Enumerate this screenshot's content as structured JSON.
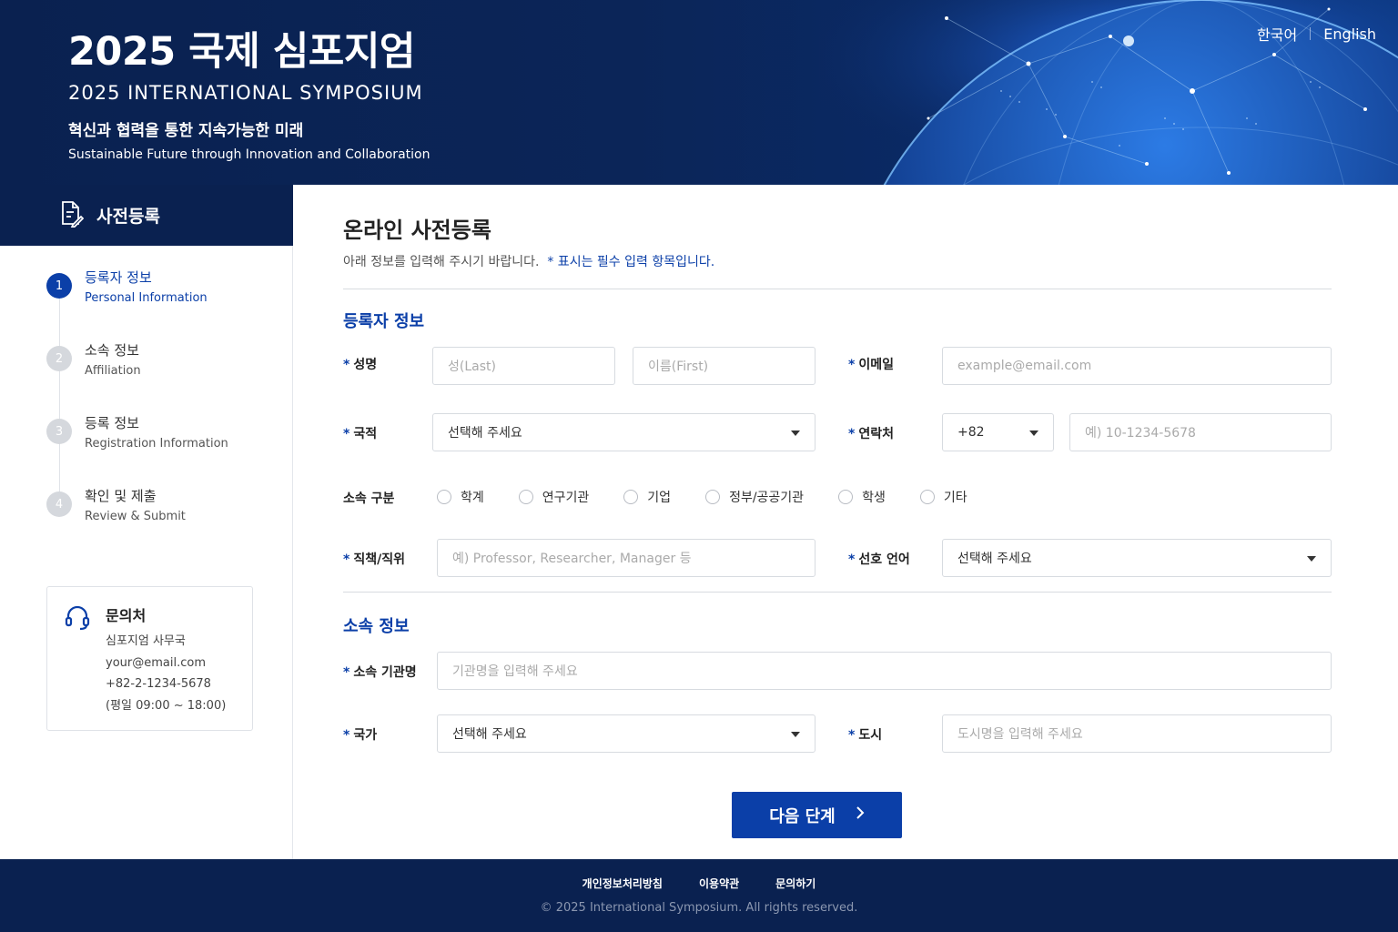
{
  "header": {
    "title_ko": "2025 국제 심포지엄",
    "title_en": "2025 INTERNATIONAL SYMPOSIUM",
    "subtitle_ko": "혁신과 협력을 통한 지속가능한 미래",
    "subtitle_en": "Sustainable Future through Innovation and Collaboration",
    "lang_ko": "한국어",
    "lang_en": "English"
  },
  "sidebar": {
    "title": "사전등록",
    "steps": [
      {
        "num": "1",
        "ko": "등록자 정보",
        "en": "Personal Information",
        "active": true
      },
      {
        "num": "2",
        "ko": "소속 정보",
        "en": "Affiliation",
        "active": false
      },
      {
        "num": "3",
        "ko": "등록 정보",
        "en": "Registration Information",
        "active": false
      },
      {
        "num": "4",
        "ko": "확인 및 제출",
        "en": "Review & Submit",
        "active": false
      }
    ],
    "contact": {
      "title": "문의처",
      "org": "심포지엄 사무국",
      "email": "your@email.com",
      "phone": "+82-2-1234-5678",
      "hours": "(평일 09:00 ~ 18:00)"
    }
  },
  "form": {
    "title": "온라인 사전등록",
    "desc": "아래 정보를 입력해 주시기 바랍니다.",
    "desc_req": "* 표시는 필수 입력 항목입니다.",
    "section1": "등록자 정보",
    "section2": "소속 정보",
    "required_mark": "*",
    "name_label": "성명",
    "last_placeholder": "성(Last)",
    "first_placeholder": "이름(First)",
    "email_label": "이메일",
    "email_placeholder": "example@email.com",
    "nationality_label": "국적",
    "nationality_value": "선택해 주세요",
    "phone_label": "연락처",
    "country_code": "+82",
    "phone_placeholder": "예) 10-1234-5678",
    "affiliation_type_label": "소속 구분",
    "affiliation_types": [
      "학계",
      "연구기관",
      "기업",
      "정부/공공기관",
      "학생",
      "기타"
    ],
    "position_label": "직책/직위",
    "position_placeholder": "예) Professor, Researcher, Manager 등",
    "pref_lang_label": "선호 언어",
    "pref_lang_value": "선택해 주세요",
    "org_label": "소속 기관명",
    "org_placeholder": "기관명을 입력해 주세요",
    "country_label": "국가",
    "country_value": "선택해 주세요",
    "city_label": "도시",
    "city_placeholder": "도시명을 입력해 주세요",
    "next_button": "다음 단계"
  },
  "footer": {
    "privacy": "개인정보처리방침",
    "terms": "이용약관",
    "inquiry": "문의하기",
    "copyright": "© 2025 International Symposium. All rights reserved."
  }
}
